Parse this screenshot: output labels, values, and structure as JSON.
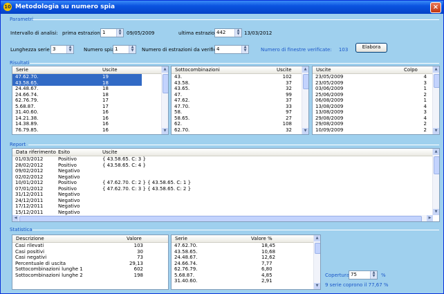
{
  "window": {
    "title": "Metodologia su numero spia",
    "icon": "app-icon",
    "close": "×"
  },
  "params": {
    "group_title": "Parametri",
    "interval_label": "Intervallo di analisi:",
    "first_label": "prima estrazione",
    "first_value": "1",
    "first_date": "09/05/2009",
    "last_label": "ultima estrazione",
    "last_value": "442",
    "last_date": "13/03/2012",
    "length_label": "Lunghezza serie",
    "length_value": "3",
    "spy_label": "Numero spia",
    "spy_value": "1",
    "draws_label": "Numero di estrazioni da verificare",
    "draws_value": "4",
    "windows_text": "Numero di finestre verificate:",
    "windows_count": "103",
    "run_button": "Elabora"
  },
  "results": {
    "group_title": "Risultati",
    "series_list": {
      "headers": [
        "Serie",
        "Uscite"
      ],
      "rows": [
        [
          "47.62.70.",
          "19"
        ],
        [
          "43.58.65.",
          "18"
        ],
        [
          "24.48.67.",
          "18"
        ],
        [
          "24.66.74.",
          "18"
        ],
        [
          "62.76.79.",
          "17"
        ],
        [
          "5.68.87.",
          "17"
        ],
        [
          "31.40.60.",
          "16"
        ],
        [
          "14.21.38.",
          "16"
        ],
        [
          "14.38.89.",
          "16"
        ],
        [
          "76.79.85.",
          "16"
        ]
      ],
      "selected": [
        0,
        1
      ]
    },
    "subcomb_list": {
      "headers": [
        "Sottocombinazioni",
        "Uscite"
      ],
      "rows": [
        [
          "43.",
          "102"
        ],
        [
          "43.58.",
          "37"
        ],
        [
          "43.65.",
          "32"
        ],
        [
          "47.",
          "99"
        ],
        [
          "47.62.",
          "37"
        ],
        [
          "47.70.",
          "33"
        ],
        [
          "58.",
          "97"
        ],
        [
          "58.65.",
          "27"
        ],
        [
          "62.",
          "108"
        ],
        [
          "62.70.",
          "32"
        ]
      ]
    },
    "outputs_list": {
      "headers": [
        "Uscite",
        "Colpo"
      ],
      "rows": [
        [
          "23/05/2009",
          "4"
        ],
        [
          "23/05/2009",
          "3"
        ],
        [
          "03/06/2009",
          "1"
        ],
        [
          "25/06/2009",
          "2"
        ],
        [
          "06/08/2009",
          "1"
        ],
        [
          "13/08/2009",
          "4"
        ],
        [
          "13/08/2009",
          "3"
        ],
        [
          "29/08/2009",
          "4"
        ],
        [
          "29/08/2009",
          "2"
        ],
        [
          "10/09/2009",
          "2"
        ]
      ]
    }
  },
  "report": {
    "group_title": "Report",
    "headers": [
      "Data riferimento",
      "Esito",
      "Uscite"
    ],
    "rows": [
      [
        "01/03/2012",
        "Positivo",
        "{ 43.58.65. C: 3 }"
      ],
      [
        "28/02/2012",
        "Positivo",
        "{ 43.58.65. C: 4 }"
      ],
      [
        "09/02/2012",
        "Negativo",
        ""
      ],
      [
        "02/02/2012",
        "Negativo",
        ""
      ],
      [
        "10/01/2012",
        "Positivo",
        "{ 47.62.70. C: 2 } { 43.58.65. C: 1 }"
      ],
      [
        "07/01/2012",
        "Positivo",
        "{ 47.62.70. C: 3 } { 43.58.65. C: 2 }"
      ],
      [
        "31/12/2011",
        "Negativo",
        ""
      ],
      [
        "24/12/2011",
        "Negativo",
        ""
      ],
      [
        "17/12/2011",
        "Negativo",
        ""
      ],
      [
        "15/12/2011",
        "Negativo",
        ""
      ]
    ]
  },
  "stats": {
    "group_title": "Statistica",
    "summary": {
      "headers": [
        "Descrizione",
        "Valore"
      ],
      "rows": [
        [
          "Casi rilevati",
          "103"
        ],
        [
          "Casi positivi",
          "30"
        ],
        [
          "Casi negativi",
          "73"
        ],
        [
          "Percentuale di uscita",
          "29,13"
        ],
        [
          "Sottocombinazioni lunghe 1",
          "602"
        ],
        [
          "Sottocombinazioni lunghe 2",
          "198"
        ]
      ]
    },
    "series_pct": {
      "headers": [
        "Serie",
        "Valore %"
      ],
      "rows": [
        [
          "47.62.70.",
          "18,45"
        ],
        [
          "43.58.65.",
          "10,68"
        ],
        [
          "24.48.67.",
          "12,62"
        ],
        [
          "24.66.74.",
          "7,77"
        ],
        [
          "62.76.79.",
          "6,80"
        ],
        [
          "5.68.87.",
          "4,85"
        ],
        [
          "31.40.60.",
          "2,91"
        ]
      ]
    },
    "coverage_label": "Copertura",
    "coverage_value": "75",
    "coverage_unit": "%",
    "coverage_result": "9 serie coprono il 77,67 %"
  },
  "colors": {
    "window_bg": "#9fd0ee",
    "title_bar": "#0a53e0",
    "selection": "#316ac5",
    "group_text": "#1a56c8"
  }
}
